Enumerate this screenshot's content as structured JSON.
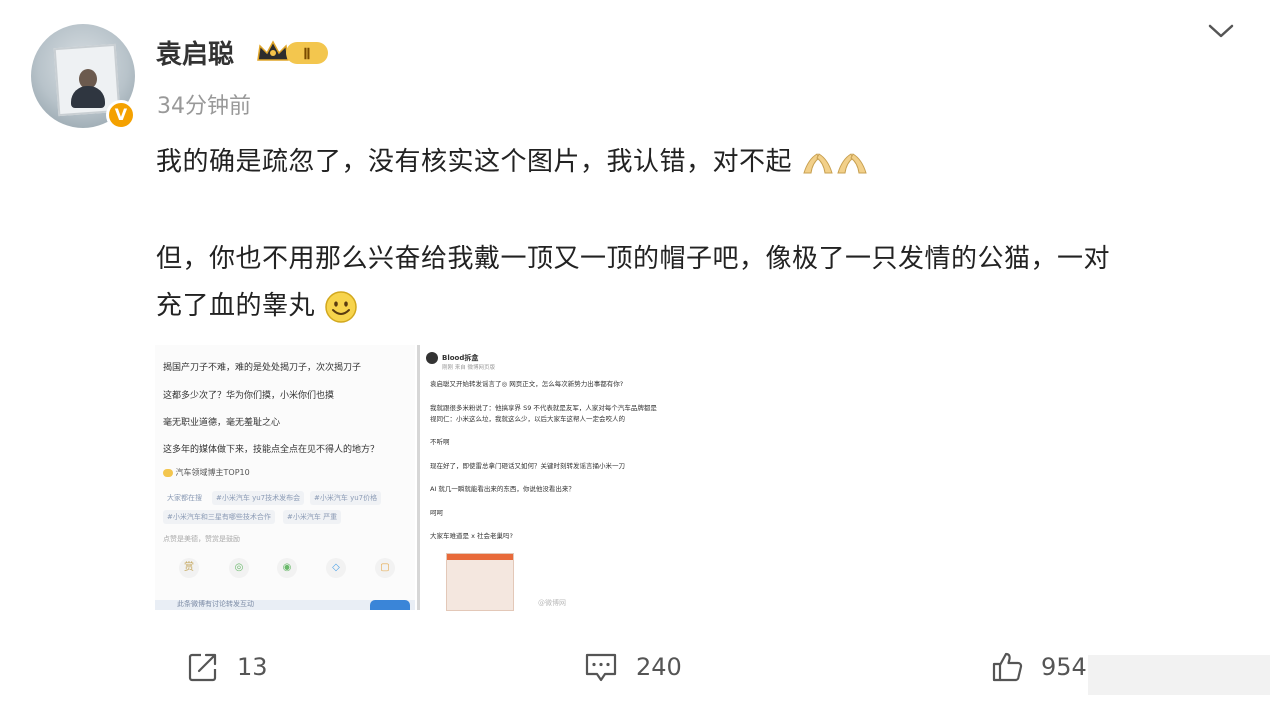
{
  "post": {
    "username": "袁启聪",
    "time": "34分钟前",
    "verified_icon": "verified-v-icon",
    "badge": {
      "icon": "crown-icon",
      "level": "Ⅱ"
    },
    "paragraphs": [
      "我的确是疏忽了，没有核实这个图片，我认错，对不起",
      "但，你也不用那么兴奋给我戴一顶又一顶的帽子吧，像极了一只发情的公猫，一对",
      "充了血的睾丸"
    ]
  },
  "embedded_image": {
    "left": {
      "lines": [
        "揭国产刀子不难，难的是处处揭刀子，次次揭刀子",
        "这都多少次了？华为你们摸，小米你们也摸",
        "毫无职业道德，毫无羞耻之心",
        "这多年的媒体做下来，技能点全点在见不得人的地方？"
      ],
      "badge_text": "汽车领域博主TOP10",
      "tags": [
        "大家都在搜",
        "#小米汽车 yu7技术发布会",
        "#小米汽车 yu7价格",
        "#小米汽车和三星有哪些技术合作",
        "#小米汽车 严重"
      ],
      "footer_text": "点赞是美德，赞赏是鼓励",
      "bottom_text": "此条微博有讨论转发互动"
    },
    "right": {
      "name": "Blood拆盒",
      "meta": "刚刚 来自 微博网页版",
      "lines": [
        "袁启聪又开始转发谣言了◎ 网页正文，怎么每次新势力出事都有你?",
        "我就跟很多米粉说了：他搞享界 S9 不代表就是友军，人家对每个汽车品牌都是",
        "视同仁：小米这么垃，我就这么少，以后大家车这帮人一定会咬人的",
        "不听啊",
        "现在好了，即使雷总拿门砸话又如何？关键时刻转发谣言捅小米一刀",
        "AI 就几一瞬就能看出来的东西，你说他没看出来？",
        "呵呵",
        "大家车难道是 x 社会老巢吗?"
      ],
      "watermark": "@微博网"
    }
  },
  "actions": {
    "repost_count": "13",
    "comment_count": "240",
    "like_count": "954"
  }
}
